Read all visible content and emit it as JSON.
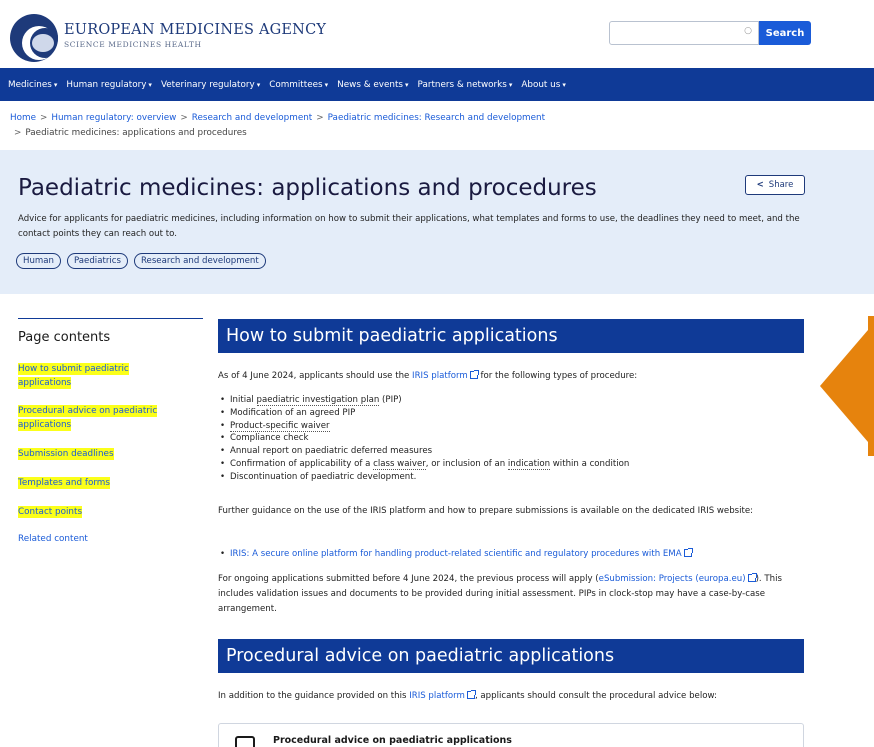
{
  "header": {
    "logo_title": "EUROPEAN MEDICINES AGENCY",
    "logo_subtitle": "SCIENCE MEDICINES HEALTH",
    "search_placeholder": "",
    "search_button": "Search",
    "search_clear": "○"
  },
  "nav": {
    "items": [
      "Medicines",
      "Human regulatory",
      "Veterinary regulatory",
      "Committees",
      "News & events",
      "Partners & networks",
      "About us"
    ],
    "caret": "▾"
  },
  "breadcrumb": {
    "items": [
      "Home",
      "Human regulatory: overview",
      "Research and development",
      "Paediatric medicines: Research and development"
    ],
    "current": "Paediatric medicines: applications and procedures",
    "separator": ">"
  },
  "hero": {
    "title": "Paediatric medicines: applications and procedures",
    "share_label": "Share",
    "share_icon": "<",
    "description": "Advice for applicants for paediatric medicines, including information on how to submit their applications, what templates and forms to use, the deadlines they need to meet, and the contact points they can reach out to.",
    "tags": [
      "Human",
      "Paediatrics",
      "Research and development"
    ]
  },
  "sidebar": {
    "title": "Page contents",
    "items": [
      "How to submit paediatric applications",
      "Procedural advice on paediatric applications",
      "Submission deadlines",
      "Templates and forms",
      "Contact points",
      "Related content"
    ],
    "highlight_color": "#fbff1a"
  },
  "main": {
    "section1": {
      "heading": "How to submit paediatric applications",
      "intro_prefix": "As of 4 June 2024, applicants should use the ",
      "intro_link": "IRIS platform",
      "intro_suffix": " for the following types of procedure:",
      "bullets": {
        "b1_pre": "Initial ",
        "b1_term": "paediatric investigation plan",
        "b1_post": " (PIP)",
        "b2": "Modification of an agreed PIP",
        "b3": "Product-specific waiver",
        "b4": "Compliance check",
        "b5": "Annual report on paediatric deferred measures",
        "b6_pre": "Confirmation of applicability of a ",
        "b6_term1": "class waiver",
        "b6_mid": ", or inclusion of an ",
        "b6_term2": "indication",
        "b6_post": " within a condition",
        "b7": "Discontinuation of paediatric development."
      },
      "guidance": "Further guidance on the use of the IRIS platform and how to prepare submissions is available on the dedicated IRIS website:",
      "iris_link": "IRIS: A secure online platform for handling product-related scientific and regulatory procedures with EMA",
      "ongoing_prefix": "For ongoing applications submitted before 4 June 2024, the previous process will apply (",
      "ongoing_link": "eSubmission: Projects (europa.eu)",
      "ongoing_suffix": "). This includes validation issues and documents to be provided during initial assessment. PIPs in clock-stop may have a case-by-case arrangement."
    },
    "section2": {
      "heading": "Procedural advice on paediatric applications",
      "intro_prefix": "In addition to the guidance provided on this ",
      "intro_link": "IRIS platform",
      "intro_suffix": ", applicants should consult the procedural advice below:",
      "card_title": "Procedural advice on paediatric applications"
    }
  },
  "colors": {
    "nav_bg": "#0f3a97",
    "link": "#1a5bd8",
    "hero_bg": "#e4edf9",
    "accent_arrow": "#e6830d"
  }
}
